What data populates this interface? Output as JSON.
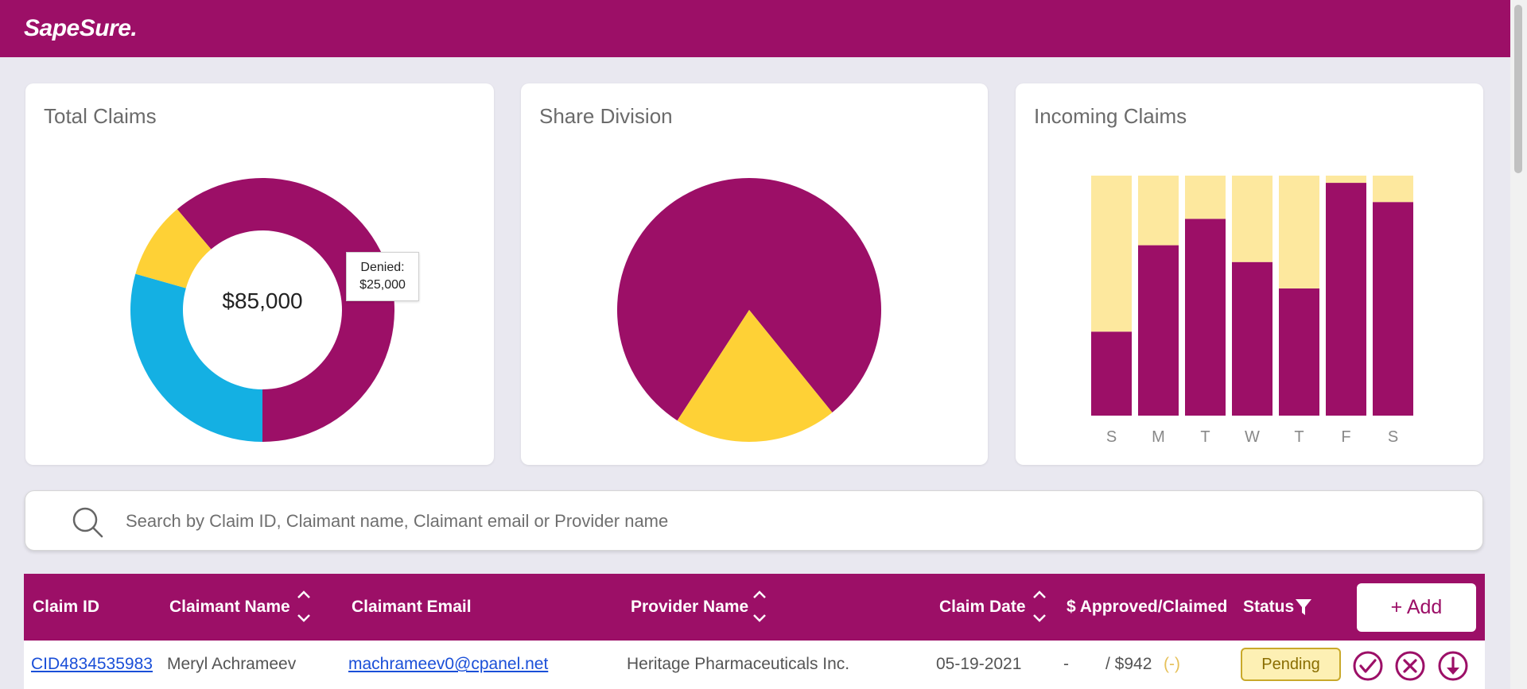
{
  "app": {
    "logo": "SapeSure."
  },
  "cards": {
    "total_claims": {
      "title": "Total Claims",
      "center_value": "$85,000",
      "tooltip_label": "Denied:",
      "tooltip_value": "$25,000"
    },
    "share_division": {
      "title": "Share Division"
    },
    "incoming_claims": {
      "title": "Incoming Claims"
    }
  },
  "colors": {
    "brand": "#9c0f67",
    "blue": "#14b0e3",
    "yellow": "#fed136",
    "light_yellow": "#fde89e"
  },
  "chart_data": [
    {
      "type": "pie",
      "variant": "donut",
      "title": "Total Claims",
      "center_label": "$85,000",
      "slices": [
        {
          "value": 52000,
          "color": "#9c0f67"
        },
        {
          "label": "Denied",
          "value": 25000,
          "color": "#14b0e3"
        },
        {
          "value": 8000,
          "color": "#fed136"
        }
      ]
    },
    {
      "type": "pie",
      "title": "Share Division",
      "slices": [
        {
          "value": 80,
          "color": "#9c0f67"
        },
        {
          "value": 20,
          "color": "#fed136"
        }
      ]
    },
    {
      "type": "bar",
      "stacked": true,
      "title": "Incoming Claims",
      "categories": [
        "S",
        "M",
        "T",
        "W",
        "T",
        "F",
        "S"
      ],
      "series": [
        {
          "values": [
            35,
            71,
            82,
            64,
            53,
            97,
            89
          ],
          "color": "#9c0f67"
        },
        {
          "values": [
            65,
            29,
            18,
            36,
            47,
            3,
            11
          ],
          "color": "#fde89e"
        }
      ],
      "ylim": [
        0,
        100
      ],
      "grid": false
    }
  ],
  "search": {
    "placeholder": "Search by Claim ID, Claimant name, Claimant email or Provider name",
    "value": ""
  },
  "table": {
    "headers": {
      "claim_id": "Claim ID",
      "claimant_name": "Claimant Name",
      "claimant_email": "Claimant Email",
      "provider_name": "Provider Name",
      "claim_date": "Claim Date",
      "approved_claimed": "$ Approved/Claimed",
      "status": "Status"
    },
    "add_label": "+ Add",
    "rows": [
      {
        "claim_id": "CID4834535983",
        "claimant_name": "Meryl Achrameev",
        "claimant_email": "machrameev0@cpanel.net",
        "provider_name": "Heritage Pharmaceuticals Inc.",
        "claim_date": "05-19-2021",
        "approved": "-",
        "claimed": "/ $942",
        "diff": "(-)",
        "status": "Pending"
      }
    ]
  }
}
